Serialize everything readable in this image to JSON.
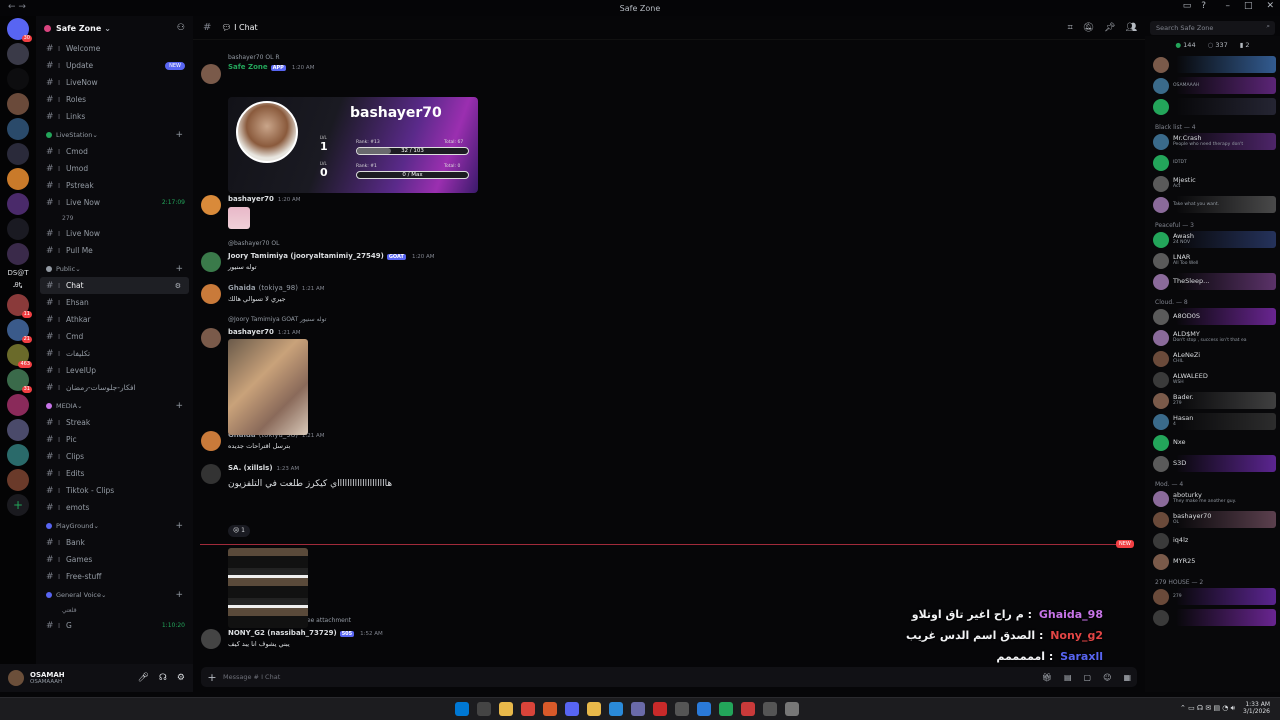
{
  "window": {
    "title": "Safe Zone"
  },
  "server": {
    "name": "Safe Zone"
  },
  "server_badges": [
    "30",
    "11",
    "21",
    "463",
    "31"
  ],
  "server_text": [
    "DS@T",
    "ᎯᎿ"
  ],
  "channels": {
    "top": [
      {
        "label": "Welcome"
      },
      {
        "label": "Update",
        "badge": "NEW"
      },
      {
        "label": "LiveNow"
      },
      {
        "label": "Roles"
      },
      {
        "label": "Links"
      }
    ],
    "livestation": {
      "title": "LiveStation",
      "items": [
        {
          "label": "Cmod"
        },
        {
          "label": "Umod"
        },
        {
          "label": "Pstreak"
        },
        {
          "label": "Live Now",
          "timer": "2:17:09"
        }
      ],
      "sub_user": "279",
      "after": [
        {
          "label": "Live Now"
        },
        {
          "label": "Pull Me"
        }
      ]
    },
    "public": {
      "title": "Public",
      "items": [
        {
          "label": "Chat",
          "active": true
        },
        {
          "label": "Ehsan"
        },
        {
          "label": "Athkar"
        },
        {
          "label": "Cmd"
        },
        {
          "label": "تكليفات"
        },
        {
          "label": "LevelUp"
        },
        {
          "label": "افكار-جلوسات-رمضان"
        }
      ]
    },
    "media": {
      "title": "MEDIA",
      "items": [
        {
          "label": "Streak"
        },
        {
          "label": "Pic"
        },
        {
          "label": "Clips"
        },
        {
          "label": "Edits"
        },
        {
          "label": "Tiktok - Clips"
        },
        {
          "label": "emots"
        }
      ]
    },
    "playground": {
      "title": "PlayGround",
      "items": [
        {
          "label": "Bank"
        },
        {
          "label": "Games"
        },
        {
          "label": "Free-stuff"
        }
      ]
    },
    "general_voice": {
      "title": "General Voice",
      "sub": "قلعتي",
      "item": {
        "label": "G",
        "timer": "1:10:20"
      }
    }
  },
  "user_panel": {
    "name": "OSAMAH",
    "status": "OSAMAAAH"
  },
  "chat": {
    "channel": "Chat",
    "input_placeholder": "Message # I Chat",
    "messages": [
      {
        "reply": "bashayer70  OL  R",
        "name": "Safe Zone",
        "tag": "APP",
        "time": "1:20 AM"
      },
      {
        "card_name": "bashayer70",
        "card_lvl1": "1",
        "card_lvl2": "0",
        "card_rank1": "Rank: #13",
        "card_total1": "Total: 67",
        "card_rank2": "Rank: #1",
        "card_total2": "Total: 0",
        "card_xp1": "32 / 103",
        "card_xp1_fill": 0.31,
        "card_xp2": "0 / Max",
        "lvl_label": "LVL"
      },
      {
        "reply": "APP  @Safe Zone Click to see attachment",
        "name": "bashayer70",
        "time": "1:20 AM"
      },
      {
        "reply": "@bashayer70  OL",
        "name": "Joory Tamimiya (jooryaltamimiy_27549)",
        "tag": "GOAT",
        "time": "1:20 AM",
        "text": "توله سنيور"
      },
      {
        "name": "Ghaida",
        "handle": "(tokiya_98)",
        "time": "1:21 AM",
        "text": "جيري لا تسوالي هالك"
      },
      {
        "reply": "@Joory Tamimiya  GOAT  توله سنيور",
        "name": "bashayer70",
        "time": "1:21 AM"
      },
      {
        "name": "Ghaida",
        "handle": "(tokiya_98)",
        "time": "1:21 AM",
        "text": "بترسل اقتراحات جديده"
      },
      {
        "name": "SA. (xillsls)",
        "time": "1:23 AM",
        "text": "هااااااااااااااااااااي كيكرز طلعت في التلفزيون"
      },
      {
        "reply": "APP  @Safe Zone Click to see attachment",
        "name": "NONY_G2 (nassibah_73729)",
        "tag": "505",
        "time": "1:52 AM",
        "text": "يبني يشوف انا يبد كيف"
      }
    ],
    "reaction_count": "1",
    "new_label": "NEW",
    "overlay": [
      {
        "text": "م راح اغير تاق اوتلاو",
        "name": "Ghaida_98",
        "color": "#c774e8"
      },
      {
        "text": "الصدق اسم الدس غريب",
        "name": "Nony_g2",
        "color": "#e24545"
      },
      {
        "text": "امممممم",
        "name": "Saraxll",
        "color": "#5865f2"
      }
    ]
  },
  "members": {
    "search_placeholder": "Search Safe Zone",
    "counts": {
      "online": "144",
      "total": "337",
      "other": "2"
    },
    "groups": [
      {
        "title": "",
        "members": [
          {
            "name": "",
            "status": "",
            "bg": "#3a6aa8"
          },
          {
            "name": "",
            "status": "OSAMAAAH",
            "bg": "#6a2a8a"
          },
          {
            "name": "",
            "status": "",
            "bg": "#2a2a3a"
          }
        ]
      },
      {
        "title": "Black list — 4",
        "members": [
          {
            "name": "Mr.Crash",
            "status": "People who need therapy don't",
            "bg": "#5a2a7a"
          },
          {
            "name": "",
            "status": "IDTDT",
            "bg": ""
          },
          {
            "name": "Mjestic",
            "status": "Act",
            "bg": ""
          },
          {
            "name": "",
            "status": "Take what you want.",
            "bg": "#555"
          }
        ]
      },
      {
        "title": "Peaceful — 3",
        "members": [
          {
            "name": "Awash",
            "status": "24 NOV",
            "bg": "#2a3a6a"
          },
          {
            "name": "LNAR",
            "status": "All Too Well",
            "bg": ""
          },
          {
            "name": "TheSleep...",
            "status": "",
            "bg": "#6a3a7a"
          }
        ]
      },
      {
        "title": "Cloud. — 8",
        "members": [
          {
            "name": "A8OD0S",
            "status": "",
            "bg": "#7a2aa8"
          },
          {
            "name": "ALD$MY",
            "status": "Don't stop , success isn't that ea",
            "bg": ""
          },
          {
            "name": "ALeNeZi",
            "status": "CHIL",
            "bg": ""
          },
          {
            "name": "ALWALEED",
            "status": "WSH",
            "bg": ""
          },
          {
            "name": "Bader.",
            "status": "279",
            "bg": "#4a4a4a"
          },
          {
            "name": "Hasan",
            "status": "4",
            "bg": "#333"
          },
          {
            "name": "Nxe",
            "status": "",
            "bg": ""
          },
          {
            "name": "S3D",
            "status": "",
            "bg": "#6a2aa8"
          }
        ]
      },
      {
        "title": "Mod. — 4",
        "members": [
          {
            "name": "aboturky",
            "status": "They make me another guy.",
            "bg": ""
          },
          {
            "name": "bashayer70",
            "status": "OL",
            "bg": "#6a4a5a"
          },
          {
            "name": "iq4lz",
            "status": "",
            "bg": ""
          },
          {
            "name": "MYR25",
            "status": "",
            "bg": ""
          }
        ]
      },
      {
        "title": "279 HOUSE — 2",
        "members": [
          {
            "name": "",
            "status": "279",
            "bg": "#6a2aa8"
          },
          {
            "name": "",
            "status": "",
            "bg": "#7a2aa8"
          }
        ]
      }
    ]
  },
  "taskbar": {
    "time": "1:33 AM",
    "date": "3/1/2026"
  },
  "colors": {
    "accent": "#5865f2",
    "danger": "#f23f43",
    "online": "#23a55a"
  }
}
